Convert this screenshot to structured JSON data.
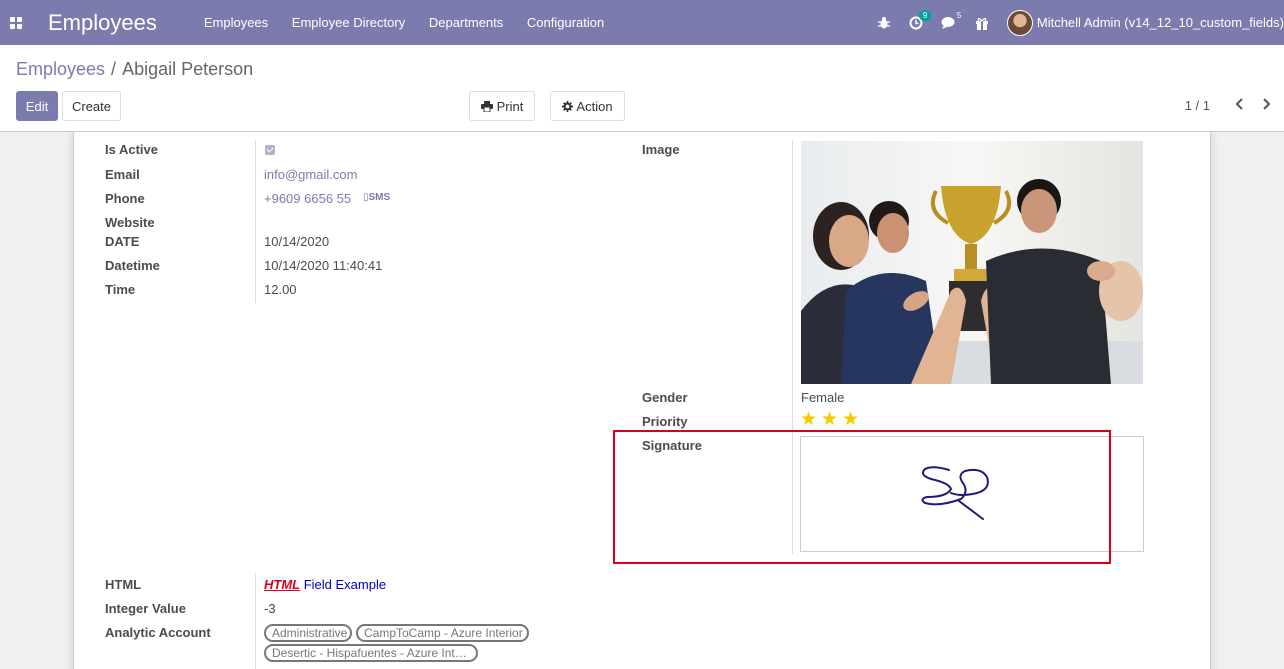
{
  "navbar": {
    "app_title": "Employees",
    "menu": [
      "Employees",
      "Employee Directory",
      "Departments",
      "Configuration"
    ],
    "activity_badge": "9",
    "messages_badge": "5",
    "user_name": "Mitchell Admin (v14_12_10_custom_fields)"
  },
  "breadcrumb": {
    "parent": "Employees",
    "separator": "/",
    "current": "Abigail Peterson"
  },
  "buttons": {
    "edit": "Edit",
    "create": "Create",
    "print": "Print",
    "action": "Action"
  },
  "pager": {
    "value": "1 / 1"
  },
  "form": {
    "is_active_label": "Is Active",
    "is_active": true,
    "email_label": "Email",
    "email": "info@gmail.com",
    "phone_label": "Phone",
    "phone": "+9609 6656 55",
    "sms_label": "SMS",
    "website_label": "Website",
    "website": "",
    "date_label": "DATE",
    "date": "10/14/2020",
    "datetime_label": "Datetime",
    "datetime": "10/14/2020 11:40:41",
    "time_label": "Time",
    "time": "12.00",
    "image_label": "Image",
    "gender_label": "Gender",
    "gender": "Female",
    "priority_label": "Priority",
    "priority_stars": 3,
    "signature_label": "Signature",
    "html_label": "HTML",
    "html_emphasis": "HTML",
    "html_rest": " Field Example",
    "integer_label": "Integer Value",
    "integer_value": "-3",
    "analytic_label": "Analytic Account",
    "analytic_tags": [
      "Administrative",
      "CampToCamp - Azure Interior",
      "Desertic - Hispafuentes - Azure Int…"
    ]
  },
  "colors": {
    "brand": "#7c7bad",
    "highlight": "#d9001b",
    "star": "#f3cc00"
  }
}
